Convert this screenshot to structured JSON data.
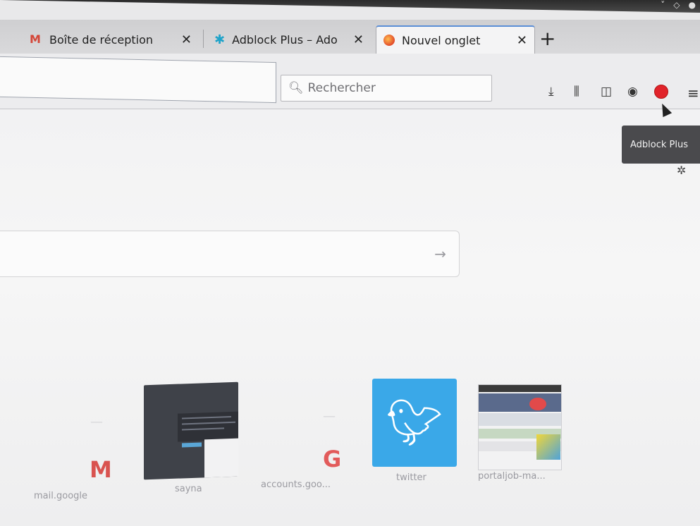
{
  "window": {
    "controls": [
      "˅",
      "◇",
      "●"
    ]
  },
  "tabs": [
    {
      "title": "Boîte de réception",
      "close": "✕",
      "icon": "gmail-icon"
    },
    {
      "title": "Adblock Plus – Ado",
      "close": "✕",
      "icon": "puzzle-icon"
    },
    {
      "title": "Nouvel onglet",
      "close": "✕",
      "icon": "firefox-icon",
      "active": true
    }
  ],
  "new_tab_label": "+",
  "search": {
    "placeholder": "Rechercher"
  },
  "toolbar": {
    "download_icon": "⤓",
    "library_icon": "⫼",
    "sidebar_icon": "◫",
    "account_icon": "◉",
    "menu_icon": "≡"
  },
  "tooltip": {
    "text": "Adblock Plus"
  },
  "newtab": {
    "search_arrow": "→",
    "gear_icon": "✲",
    "top_sites": [
      {
        "label": "mail.google"
      },
      {
        "label": "sayna"
      },
      {
        "label": "accounts.goo..."
      },
      {
        "label": "twitter"
      },
      {
        "label": "portaljob-ma..."
      }
    ]
  },
  "colors": {
    "accent": "#5b8ed6",
    "twitter": "#3aa8e8",
    "adblock_red": "#e1232a"
  }
}
